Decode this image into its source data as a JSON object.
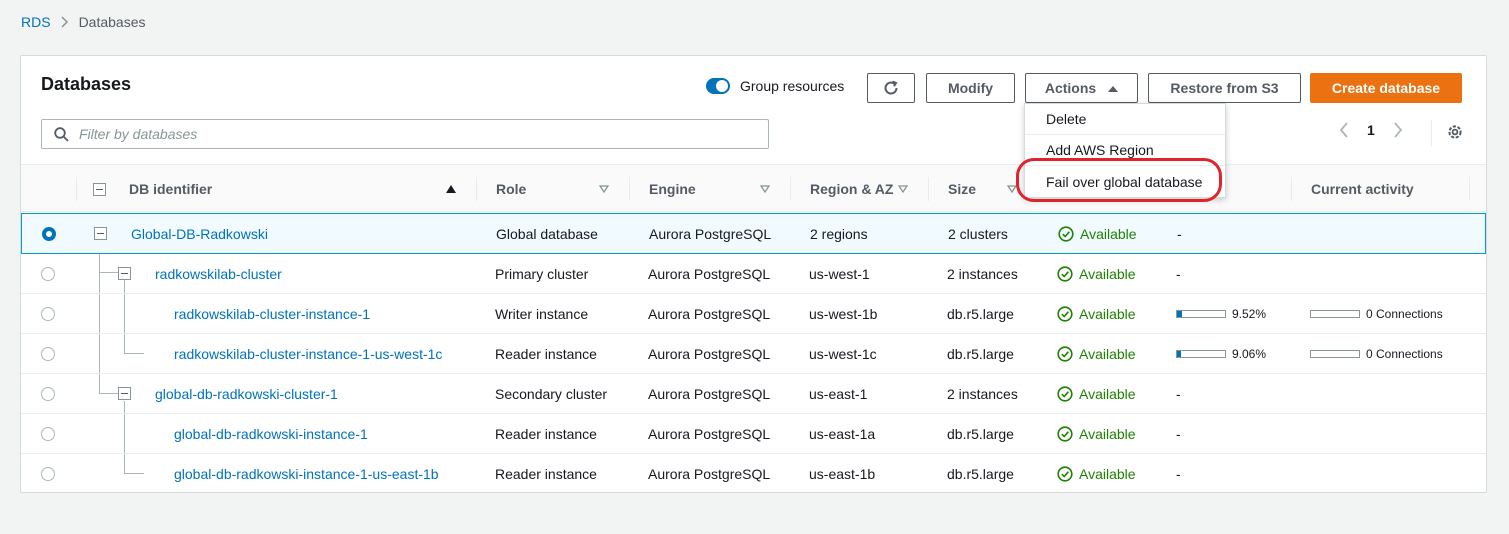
{
  "breadcrumb": {
    "root": "RDS",
    "current": "Databases"
  },
  "panel": {
    "title": "Databases"
  },
  "toolbar": {
    "group_label": "Group resources",
    "modify": "Modify",
    "actions": "Actions",
    "restore": "Restore from S3",
    "create": "Create database"
  },
  "filter": {
    "placeholder": "Filter by databases"
  },
  "pager": {
    "page": "1"
  },
  "actions_menu": [
    "Delete",
    "Add AWS Region",
    "Fail over global database"
  ],
  "columns": {
    "id": "DB identifier",
    "role": "Role",
    "engine": "Engine",
    "region": "Region & AZ",
    "size": "Size",
    "activity": "Current activity"
  },
  "rows": [
    {
      "id": "Global-DB-Radkowski",
      "role": "Global database",
      "engine": "Aurora PostgreSQL",
      "region": "2 regions",
      "size": "2 clusters",
      "status": "Available",
      "cpu": "-",
      "cpu_value": null,
      "activity": ""
    },
    {
      "id": "radkowskilab-cluster",
      "role": "Primary cluster",
      "engine": "Aurora PostgreSQL",
      "region": "us-west-1",
      "size": "2 instances",
      "status": "Available",
      "cpu": "-",
      "cpu_value": null,
      "activity": ""
    },
    {
      "id": "radkowskilab-cluster-instance-1",
      "role": "Writer instance",
      "engine": "Aurora PostgreSQL",
      "region": "us-west-1b",
      "size": "db.r5.large",
      "status": "Available",
      "cpu": "9.52%",
      "cpu_value": 9.52,
      "activity": "0 Connections"
    },
    {
      "id": "radkowskilab-cluster-instance-1-us-west-1c",
      "role": "Reader instance",
      "engine": "Aurora PostgreSQL",
      "region": "us-west-1c",
      "size": "db.r5.large",
      "status": "Available",
      "cpu": "9.06%",
      "cpu_value": 9.06,
      "activity": "0 Connections"
    },
    {
      "id": "global-db-radkowski-cluster-1",
      "role": "Secondary cluster",
      "engine": "Aurora PostgreSQL",
      "region": "us-east-1",
      "size": "2 instances",
      "status": "Available",
      "cpu": "-",
      "cpu_value": null,
      "activity": ""
    },
    {
      "id": "global-db-radkowski-instance-1",
      "role": "Reader instance",
      "engine": "Aurora PostgreSQL",
      "region": "us-east-1a",
      "size": "db.r5.large",
      "status": "Available",
      "cpu": "-",
      "cpu_value": null,
      "activity": ""
    },
    {
      "id": "global-db-radkowski-instance-1-us-east-1b",
      "role": "Reader instance",
      "engine": "Aurora PostgreSQL",
      "region": "us-east-1b",
      "size": "db.r5.large",
      "status": "Available",
      "cpu": "-",
      "cpu_value": null,
      "activity": ""
    }
  ],
  "colors": {
    "link": "#0073bb",
    "primary": "#ec7211",
    "success": "#1d8102",
    "highlight": "#e0242b"
  }
}
